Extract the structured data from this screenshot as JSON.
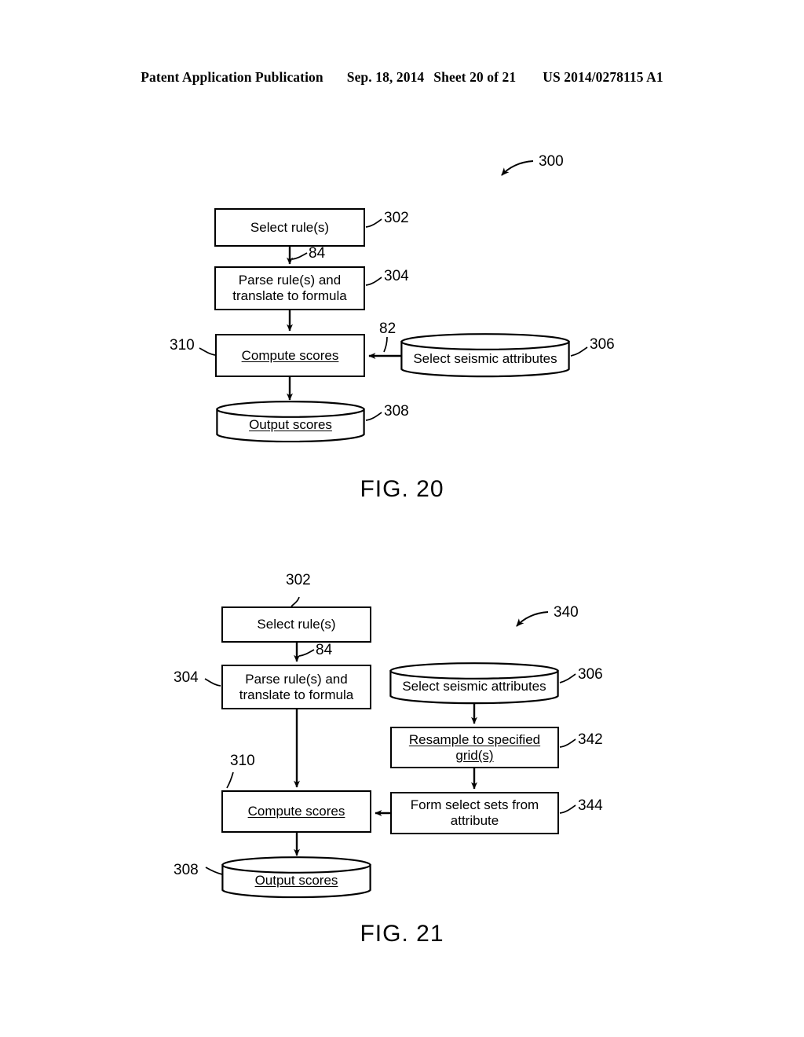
{
  "header": {
    "publication": "Patent Application Publication",
    "date": "Sep. 18, 2014",
    "sheet": "Sheet 20 of 21",
    "patent_number": "US 2014/0278115 A1"
  },
  "figures": [
    {
      "caption": "FIG. 20",
      "diagram_ref": "300",
      "nodes": [
        {
          "id": "302",
          "shape": "rect",
          "label_line1": "Select rule(s)",
          "label_line2": "",
          "underline": false
        },
        {
          "id": "304",
          "shape": "rect",
          "label_line1": "Parse rule(s) and",
          "label_line2": "translate to formula",
          "underline": false
        },
        {
          "id": "310",
          "shape": "rect",
          "label_line1": "Compute scores",
          "label_line2": "",
          "underline": true
        },
        {
          "id": "306",
          "shape": "cylinder",
          "label_line1": "Select seismic attributes",
          "label_line2": "",
          "underline": false
        },
        {
          "id": "308",
          "shape": "cylinder",
          "label_line1": "Output scores",
          "label_line2": "",
          "underline": true
        }
      ],
      "edge_refs": [
        {
          "id": "84",
          "from": "302",
          "to": "304"
        },
        {
          "id": "82",
          "from": "306",
          "to": "310"
        }
      ]
    },
    {
      "caption": "FIG. 21",
      "diagram_ref": "340",
      "nodes": [
        {
          "id": "302",
          "shape": "rect",
          "label_line1": "Select rule(s)",
          "label_line2": "",
          "underline": false
        },
        {
          "id": "304",
          "shape": "rect",
          "label_line1": "Parse rule(s) and",
          "label_line2": "translate to formula",
          "underline": false
        },
        {
          "id": "310",
          "shape": "rect",
          "label_line1": "Compute scores",
          "label_line2": "",
          "underline": true
        },
        {
          "id": "306",
          "shape": "cylinder",
          "label_line1": "Select seismic attributes",
          "label_line2": "",
          "underline": false
        },
        {
          "id": "342",
          "shape": "rect",
          "label_line1": "Resample to specified",
          "label_line2": "grid(s)",
          "underline": true
        },
        {
          "id": "344",
          "shape": "rect",
          "label_line1": "Form select sets from",
          "label_line2": "attribute",
          "underline": false
        },
        {
          "id": "308",
          "shape": "cylinder",
          "label_line1": "Output scores",
          "label_line2": "",
          "underline": true
        }
      ],
      "edge_refs": [
        {
          "id": "84",
          "from": "302",
          "to": "304"
        }
      ]
    }
  ]
}
